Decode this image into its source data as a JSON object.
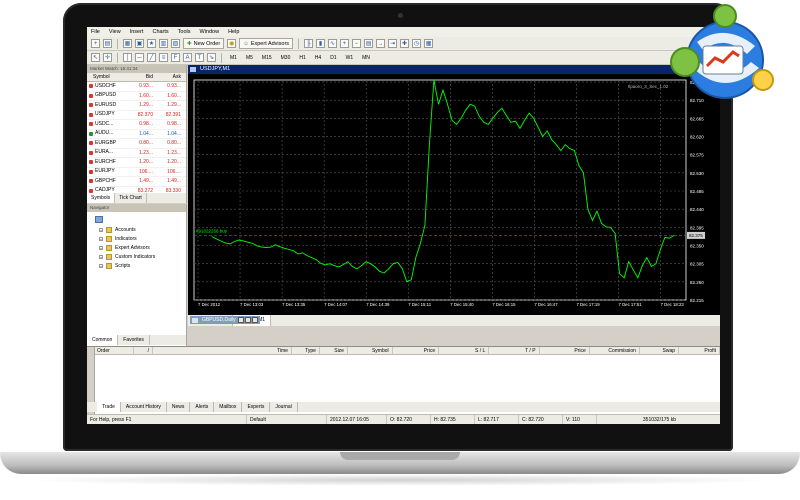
{
  "menu": [
    "File",
    "View",
    "Insert",
    "Charts",
    "Tools",
    "Window",
    "Help"
  ],
  "toolbar": {
    "new_order": "New Order",
    "expert_advisors": "Expert Advisors",
    "timeframes": [
      "M1",
      "M5",
      "M15",
      "M30",
      "H1",
      "H4",
      "D1",
      "W1",
      "MN"
    ]
  },
  "market_watch": {
    "title": "Market Watch: 15:41:34",
    "headers": [
      "Symbol",
      "Bid",
      "Ask"
    ],
    "rows": [
      {
        "symbol": "USDCHF",
        "bid": "0.93...",
        "ask": "0.93...",
        "dir": "down"
      },
      {
        "symbol": "GBPUSD",
        "bid": "1.60...",
        "ask": "1.60...",
        "dir": "down"
      },
      {
        "symbol": "EURUSD",
        "bid": "1.29...",
        "ask": "1.29...",
        "dir": "down"
      },
      {
        "symbol": "USDJPY",
        "bid": "82.370",
        "ask": "82.391",
        "dir": "down"
      },
      {
        "symbol": "USDC...",
        "bid": "0.98...",
        "ask": "0.98...",
        "dir": "down"
      },
      {
        "symbol": "AUDU...",
        "bid": "1.04...",
        "ask": "1.04...",
        "dir": "up"
      },
      {
        "symbol": "EURGBP",
        "bid": "0.80...",
        "ask": "0.80...",
        "dir": "down"
      },
      {
        "symbol": "EURA...",
        "bid": "1.23...",
        "ask": "1.23...",
        "dir": "down"
      },
      {
        "symbol": "EURCHF",
        "bid": "1.20...",
        "ask": "1.20...",
        "dir": "down"
      },
      {
        "symbol": "EURJPY",
        "bid": "106....",
        "ask": "106....",
        "dir": "down"
      },
      {
        "symbol": "GBPCHF",
        "bid": "1.49...",
        "ask": "1.49...",
        "dir": "down"
      },
      {
        "symbol": "CADJPY",
        "bid": "83.272",
        "ask": "83.330",
        "dir": "down"
      }
    ],
    "tabs": [
      "Symbols",
      "Tick Chart"
    ]
  },
  "navigator": {
    "title": "Navigator",
    "items": [
      "Accounts",
      "Indicators",
      "Expert Advisors",
      "Custom Indicators",
      "Scripts"
    ],
    "tabs": [
      "Common",
      "Favorites"
    ]
  },
  "chart": {
    "title": "USDJPY,M1",
    "indicator_label": "Ilpaoro_3_Sec_1.02",
    "order_label": "#91022266 buy",
    "price_tag": "82.375",
    "colors": {
      "line": "#00ff00",
      "grid": "#5a5a5a",
      "axis": "#ffffff",
      "bg": "#000000"
    }
  },
  "chart_data": {
    "type": "line",
    "title": "USDJPY,M1",
    "xlabel": "",
    "ylabel": "",
    "x_ticks": [
      "7 Dec 2012",
      "7 Dec 13:03",
      "7 Dec 13:35",
      "7 Dec 14:07",
      "7 Dec 14:39",
      "7 Dec 15:11",
      "7 Dec 15:40",
      "7 Dec 16:15",
      "7 Dec 16:47",
      "7 Dec 17:19",
      "7 Dec 17:51",
      "7 Dec 18:23"
    ],
    "y_ticks": [
      "82.755",
      "82.710",
      "82.665",
      "82.620",
      "82.575",
      "82.530",
      "82.485",
      "82.440",
      "82.395",
      "82.350",
      "82.305",
      "82.260",
      "82.215"
    ],
    "ylim": [
      82.215,
      82.76
    ],
    "series": [
      {
        "values": [
          82.372,
          82.366,
          82.361,
          82.356,
          82.354,
          82.36,
          82.364,
          82.361,
          82.358,
          82.355,
          82.349,
          82.346,
          82.345,
          82.346,
          82.352,
          82.347,
          82.343,
          82.34,
          82.337,
          82.329,
          82.332,
          82.325,
          82.32,
          82.315,
          82.306,
          82.302,
          82.305,
          82.3,
          82.297,
          82.303,
          82.31,
          82.298,
          82.292,
          82.3,
          82.31,
          82.305,
          82.297,
          82.286,
          82.282,
          82.292,
          82.305,
          82.308,
          82.293,
          82.26,
          82.265,
          82.32,
          82.355,
          82.4,
          82.6,
          82.76,
          82.7,
          82.735,
          82.7,
          82.66,
          82.65,
          82.665,
          82.685,
          82.7,
          82.695,
          82.67,
          82.655,
          82.65,
          82.665,
          82.68,
          82.69,
          82.672,
          82.655,
          82.658,
          82.64,
          82.66,
          82.678,
          82.665,
          82.643,
          82.62,
          82.634,
          82.612,
          82.6,
          82.585,
          82.6,
          82.59,
          82.585,
          82.548,
          82.53,
          82.44,
          82.412,
          82.435,
          82.405,
          82.396,
          82.395,
          82.38,
          82.28,
          82.27,
          82.31,
          82.29,
          82.27,
          82.3,
          82.32,
          82.298,
          82.305,
          82.34,
          82.37,
          82.368,
          82.375
        ]
      }
    ]
  },
  "chart_tabs": [
    "GBPUSD,Daily",
    "USDJPY,M1"
  ],
  "mini_window_title": "GBPUSD,Daily",
  "terminal": {
    "headers": [
      "Order",
      "/",
      "Time",
      "Type",
      "Size",
      "Symbol",
      "Price",
      "S / L",
      "T / P",
      "Price",
      "Commission",
      "Swap",
      "Profit"
    ],
    "side_label": "Terminal",
    "tabs": [
      "Trade",
      "Account History",
      "News",
      "Alerts",
      "Mailbox",
      "Experts",
      "Journal"
    ]
  },
  "status": {
    "help": "For Help, press F1",
    "profile": "Default",
    "time": "2012.12.07 16:05",
    "open": "O: 82.720",
    "high": "H: 82.735",
    "low": "L: 82.717",
    "close": "C: 82.720",
    "volume": "V: 110",
    "traffic": "351032/175 kb"
  }
}
